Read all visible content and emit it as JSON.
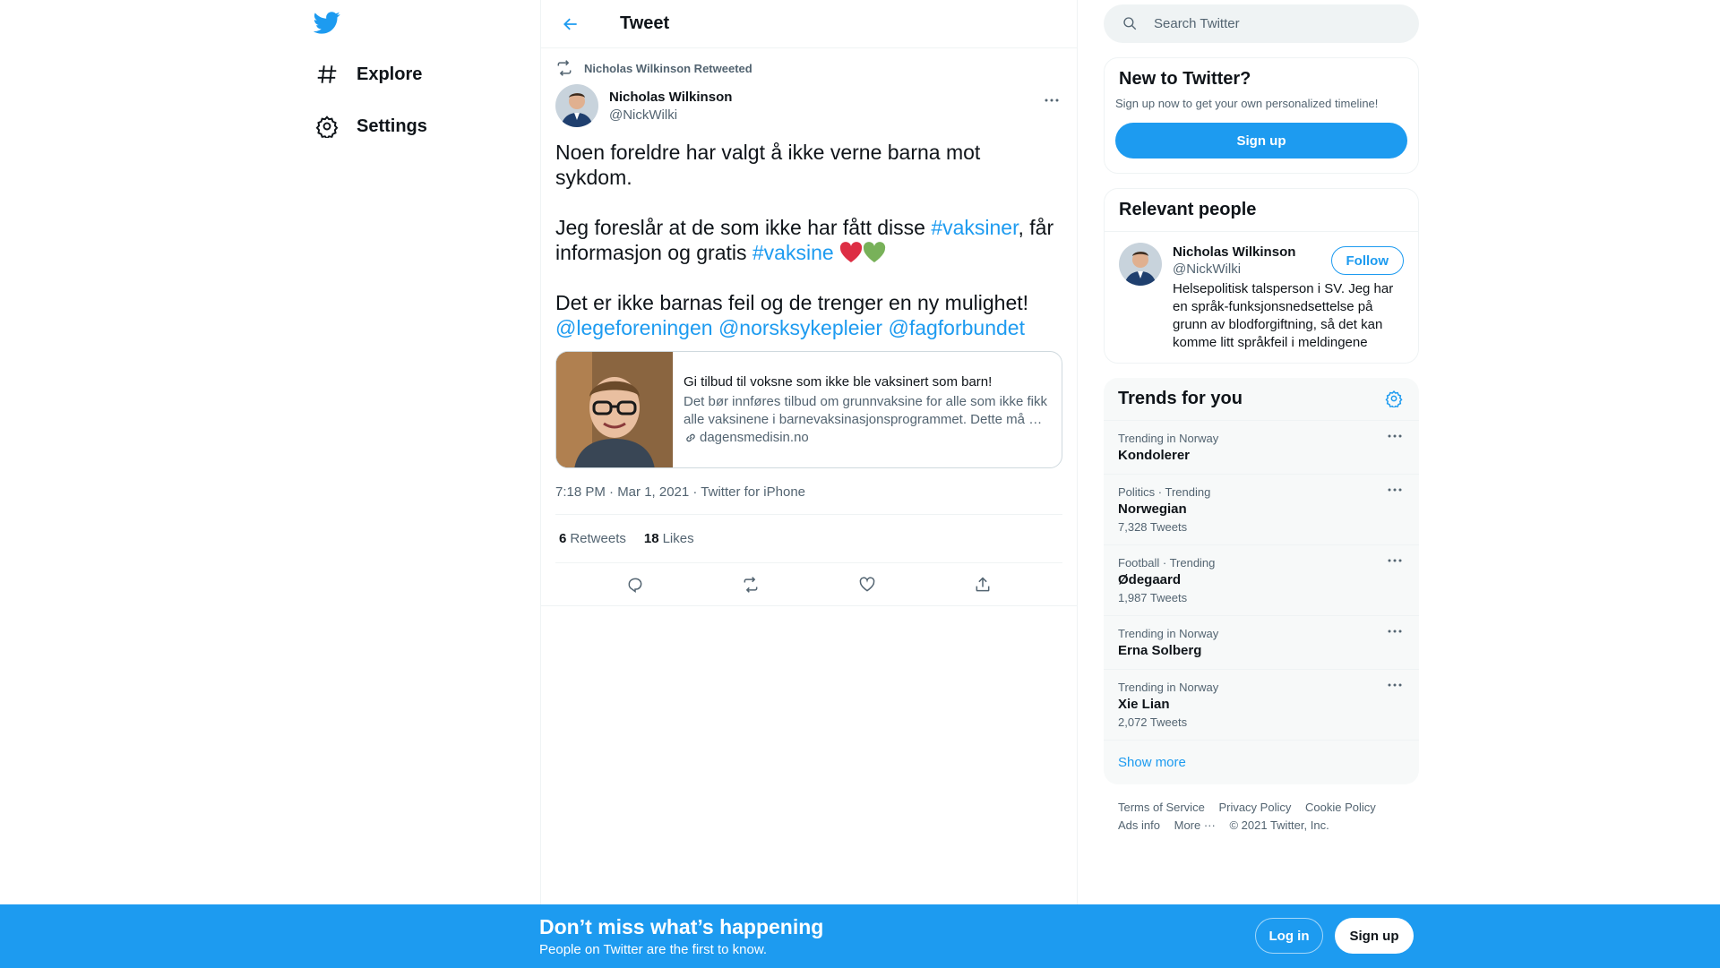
{
  "nav": {
    "items": [
      {
        "label": "Explore",
        "icon": "hashtag-icon"
      },
      {
        "label": "Settings",
        "icon": "gear-icon"
      }
    ]
  },
  "header": {
    "title": "Tweet"
  },
  "tweet": {
    "retweeted_by": "Nicholas Wilkinson Retweeted",
    "author_name": "Nicholas Wilkinson",
    "author_handle": "@NickWilki",
    "para1": "Noen foreldre har valgt å ikke verne barna mot sykdom.",
    "para2_a": "Jeg foreslår at de som ikke har fått disse ",
    "para2_tag1": "#vaksiner",
    "para2_b": ", får informasjon og gratis ",
    "para2_tag2": "#vaksine",
    "para3": "Det er ikke barnas feil og de trenger en ny mulighet!",
    "mention1": "@legeforeningen",
    "mention2": "@norsksykepleier",
    "mention3": "@fagforbundet",
    "card": {
      "title": "Gi tilbud til voksne som ikke ble vaksinert som barn!",
      "description": "Det bør innføres tilbud om grunnvaksine for alle som ikke fikk alle vaksinene i barnevaksinasjonsprogrammet. Dette må …",
      "domain": "dagensmedisin.no"
    },
    "meta": "7:18 PM · Mar 1, 2021 · Twitter for iPhone",
    "retweets_count": "6",
    "retweets_label": "Retweets",
    "likes_count": "18",
    "likes_label": "Likes"
  },
  "search": {
    "placeholder": "Search Twitter"
  },
  "new_to_twitter": {
    "title": "New to Twitter?",
    "subtitle": "Sign up now to get your own personalized timeline!",
    "button": "Sign up"
  },
  "relevant": {
    "title": "Relevant people",
    "name": "Nicholas Wilkinson",
    "handle": "@NickWilki",
    "bio": "Helsepolitisk talsperson i SV. Jeg har en språk-funksjonsnedsettelse på grunn av blodforgiftning, så det kan komme litt språkfeil i meldingene",
    "follow": "Follow"
  },
  "trends": {
    "title": "Trends for you",
    "items": [
      {
        "context": "Trending in Norway",
        "name": "Kondolerer",
        "count": ""
      },
      {
        "context": "Politics · Trending",
        "name": "Norwegian",
        "count": "7,328 Tweets"
      },
      {
        "context": "Football · Trending",
        "name": "Ødegaard",
        "count": "1,987 Tweets"
      },
      {
        "context": "Trending in Norway",
        "name": "Erna Solberg",
        "count": ""
      },
      {
        "context": "Trending in Norway",
        "name": "Xie Lian",
        "count": "2,072 Tweets"
      }
    ],
    "show_more": "Show more"
  },
  "footer": {
    "terms": "Terms of Service",
    "privacy": "Privacy Policy",
    "cookie": "Cookie Policy",
    "ads": "Ads info",
    "more": "More ···",
    "copyright": "© 2021 Twitter, Inc."
  },
  "bottom_bar": {
    "title": "Don’t miss what’s happening",
    "subtitle": "People on Twitter are the first to know.",
    "login": "Log in",
    "signup": "Sign up"
  },
  "colors": {
    "accent": "#1d9bf0",
    "text": "#0f1419",
    "secondary": "#536471"
  }
}
